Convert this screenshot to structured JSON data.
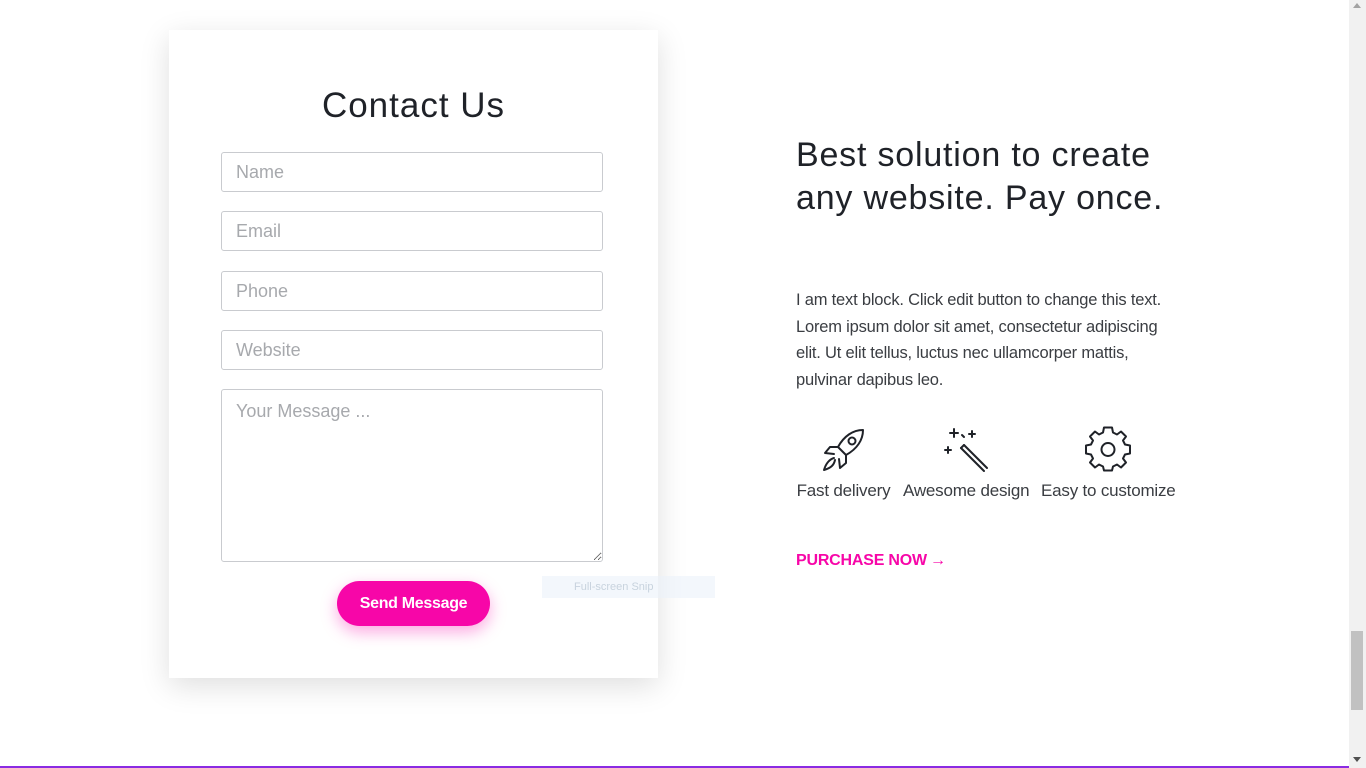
{
  "contact": {
    "title": "Contact Us",
    "fields": {
      "name_placeholder": "Name",
      "email_placeholder": "Email",
      "phone_placeholder": "Phone",
      "website_placeholder": "Website",
      "message_placeholder": "Your Message ..."
    },
    "send_label": "Send Message"
  },
  "overlay": {
    "snip_label": "Full-screen Snip"
  },
  "promo": {
    "headline": "Best solution to create any website. Pay once.",
    "body": "I am text block. Click edit button to change this text. Lorem ipsum dolor sit amet, consectetur adipiscing elit. Ut elit tellus, luctus nec ullamcorper mattis, pulvinar dapibus leo.",
    "features": [
      {
        "icon": "rocket-icon",
        "label": "Fast delivery"
      },
      {
        "icon": "magic-wand-icon",
        "label": "Awesome design"
      },
      {
        "icon": "gear-icon",
        "label": "Easy to customize"
      }
    ],
    "purchase_label": "PURCHASE NOW",
    "purchase_arrow": "→"
  },
  "colors": {
    "accent": "#f706a8",
    "text": "#1f2228",
    "body_text": "#3a3d42"
  }
}
